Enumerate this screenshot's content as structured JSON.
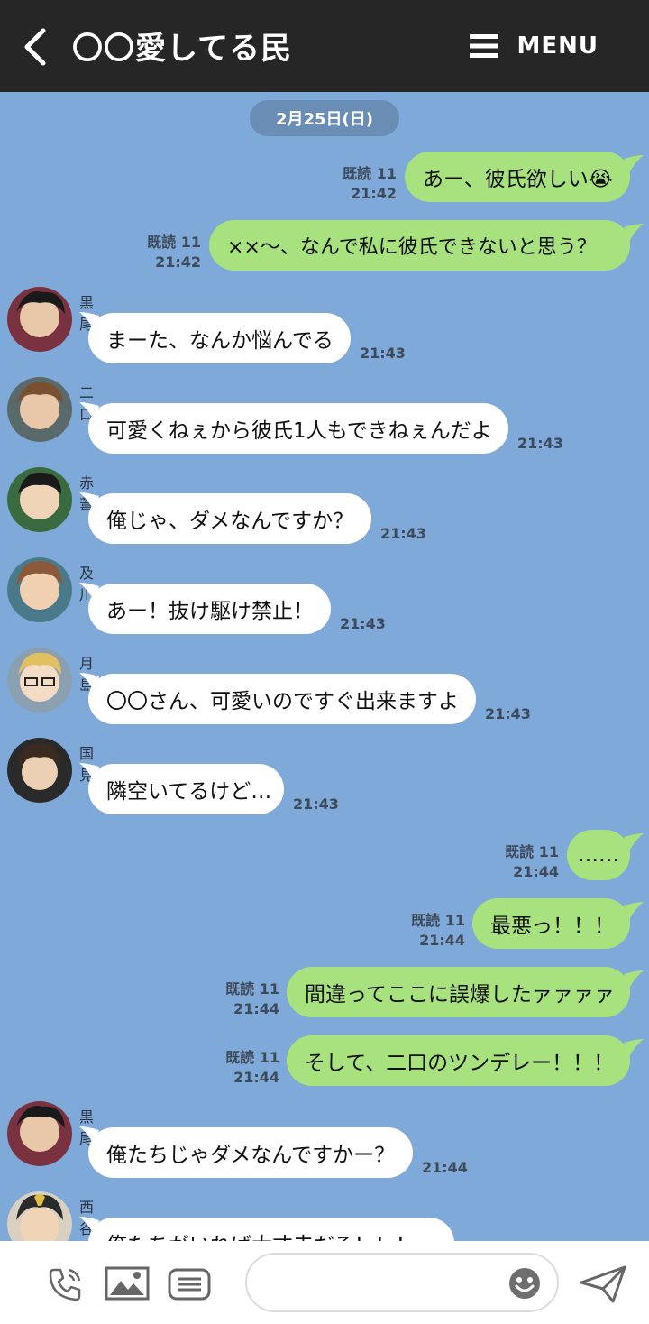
{
  "header": {
    "title": "〇〇愛してる民",
    "menu_label": "MENU"
  },
  "date": "2月25日(日)",
  "messages": [
    {
      "dir": "out",
      "text": "あー、彼氏欲しい😭",
      "read": "既読 11",
      "time": "21:42"
    },
    {
      "dir": "out",
      "text": "××〜、なんで私に彼氏できないと思う？",
      "read": "既読 11",
      "time": "21:42"
    },
    {
      "dir": "in",
      "name": "黒尾",
      "text": "まーた、なんか悩んでる",
      "time": "21:43"
    },
    {
      "dir": "in",
      "name": "二口",
      "text": "可愛くねぇから彼氏1人もできねぇんだよ",
      "time": "21:43"
    },
    {
      "dir": "in",
      "name": "赤葦",
      "text": "俺じゃ、ダメなんですか？",
      "time": "21:43"
    },
    {
      "dir": "in",
      "name": "及川",
      "text": "あー！抜け駆け禁止！",
      "time": "21:43"
    },
    {
      "dir": "in",
      "name": "月島",
      "text": "〇〇さん、可愛いのですぐ出来ますよ",
      "time": "21:43"
    },
    {
      "dir": "in",
      "name": "国見",
      "text": "隣空いてるけど…",
      "time": "21:43"
    },
    {
      "dir": "out",
      "text": "……",
      "read": "既読 11",
      "time": "21:44"
    },
    {
      "dir": "out",
      "text": "最悪っ！！！",
      "read": "既読 11",
      "time": "21:44"
    },
    {
      "dir": "out",
      "text": "間違ってここに誤爆したァァァァ",
      "read": "既読 11",
      "time": "21:44"
    },
    {
      "dir": "out",
      "text": "そして、二口のツンデレー！！！",
      "read": "既読 11",
      "time": "21:44"
    },
    {
      "dir": "in",
      "name": "黒尾",
      "text": "俺たちじゃダメなんですかー？",
      "time": "21:44"
    },
    {
      "dir": "in",
      "name": "西谷",
      "text": "俺たちがいれば大丈夫だろ！！！"
    }
  ],
  "input": {
    "placeholder": ""
  },
  "icons": {
    "back": "chevron-left-icon",
    "menu": "hamburger-icon",
    "call": "phone-icon",
    "image": "image-icon",
    "sticker": "keyboard-icon",
    "emoji": "smiley-icon",
    "send": "send-icon"
  },
  "colors": {
    "background": "#7fa9d8",
    "header": "#262626",
    "outgoing_bubble": "#a8e27e",
    "incoming_bubble": "#ffffff",
    "date_pill": "#6a8db5"
  }
}
